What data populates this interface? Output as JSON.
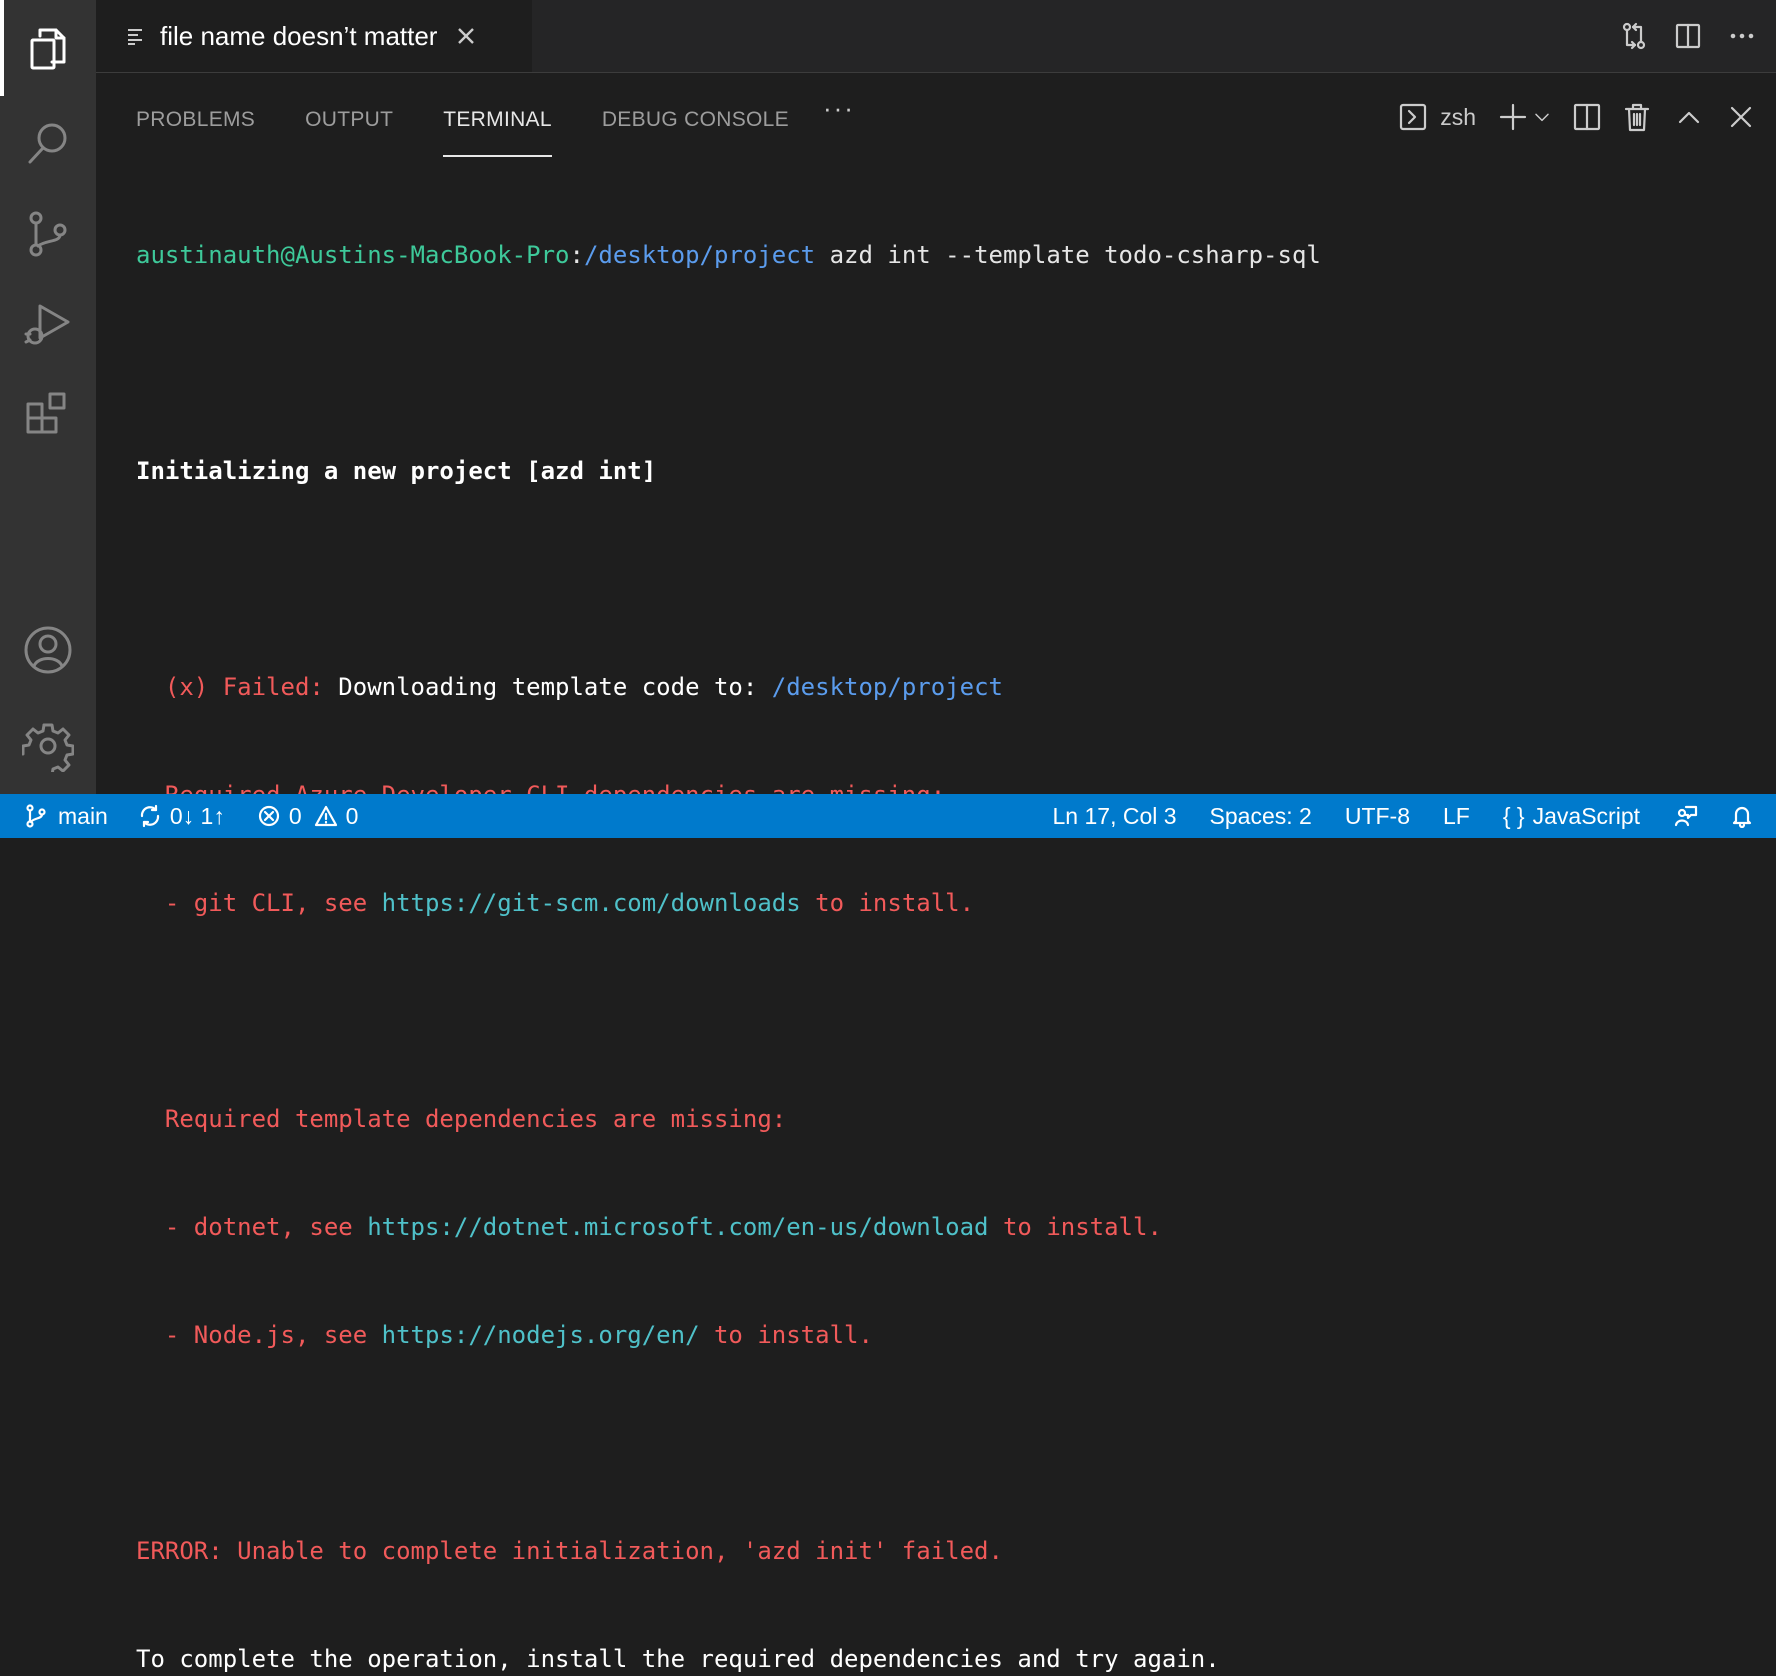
{
  "editor": {
    "tab_label": "file name doesn’t matter"
  },
  "panel": {
    "tabs": [
      "PROBLEMS",
      "OUTPUT",
      "TERMINAL",
      "DEBUG CONSOLE"
    ],
    "more": "···",
    "shell": "zsh"
  },
  "terminal": {
    "prompt_user": "austinauth@Austins-MacBook-Pro",
    "prompt_colon": ":",
    "prompt_path": "/desktop/project",
    "command": " azd int --template todo-csharp-sql",
    "heading": "Initializing a new project [azd int]",
    "failed_label": "  (x) Failed: ",
    "failed_text": "Downloading template code to: ",
    "failed_path": "/desktop/project",
    "cli_missing": "  Required Azure Developer CLI dependencies are missing:",
    "git_prefix": "  - git CLI, see ",
    "git_url": "https://git-scm.com/downloads",
    "git_suffix": " to install.",
    "tpl_missing": "  Required template dependencies are missing:",
    "dotnet_prefix": "  - dotnet, see ",
    "dotnet_url": "https://dotnet.microsoft.com/en-us/download",
    "dotnet_suffix": " to install.",
    "node_prefix": "  - Node.js, see ",
    "node_url": "https://nodejs.org/en/",
    "node_suffix": " to install.",
    "error_line": "ERROR: Unable to complete initialization, 'azd init' failed.",
    "hint_line": "To complete the operation, install the required dependencies and try again."
  },
  "status": {
    "branch": "main",
    "sync": "0↓ 1↑",
    "errors": "0",
    "warnings": "0",
    "position": "Ln 17, Col 3",
    "spaces": "Spaces: 2",
    "encoding": "UTF-8",
    "eol": "LF",
    "language": "JavaScript"
  },
  "colors": {
    "statusbar": "#007acc",
    "activitybar": "#333333",
    "terminal_bg": "#1e1e1e"
  }
}
